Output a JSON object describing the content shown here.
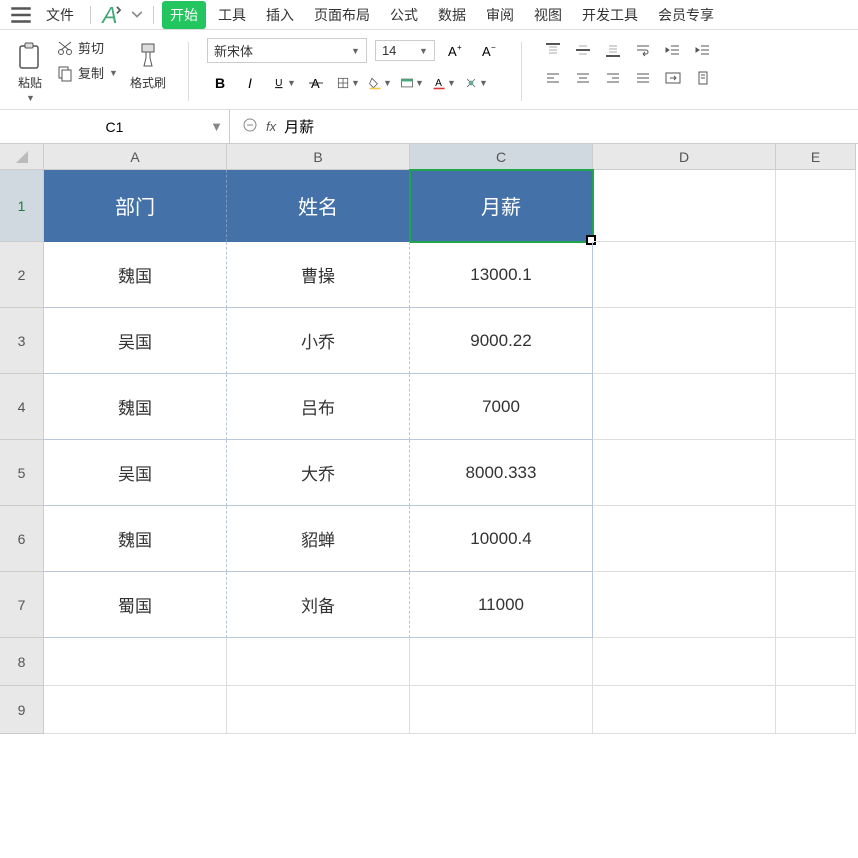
{
  "menu": {
    "file": "文件",
    "items": [
      "开始",
      "工具",
      "插入",
      "页面布局",
      "公式",
      "数据",
      "审阅",
      "视图",
      "开发工具",
      "会员专享"
    ],
    "active_index": 0
  },
  "ribbon": {
    "paste": "粘贴",
    "cut": "剪切",
    "copy": "复制",
    "format_painter": "格式刷",
    "font_name": "新宋体",
    "font_size": "14"
  },
  "formula": {
    "cell_ref": "C1",
    "value": "月薪"
  },
  "columns": [
    "A",
    "B",
    "C",
    "D",
    "E"
  ],
  "table": {
    "headers": [
      "部门",
      "姓名",
      "月薪"
    ],
    "rows": [
      [
        "魏国",
        "曹操",
        "13000.1"
      ],
      [
        "吴国",
        "小乔",
        "9000.22"
      ],
      [
        "魏国",
        "吕布",
        "7000"
      ],
      [
        "吴国",
        "大乔",
        "8000.333"
      ],
      [
        "魏国",
        "貂蝉",
        "10000.4"
      ],
      [
        "蜀国",
        "刘备",
        "11000"
      ]
    ]
  },
  "selected_cell": "C1"
}
